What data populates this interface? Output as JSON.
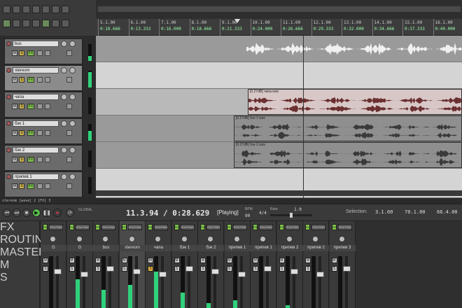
{
  "ruler": {
    "bars": [
      {
        "bar": "5.1.00",
        "time": "0:10.666"
      },
      {
        "bar": "6.1.00",
        "time": "0:13.333"
      },
      {
        "bar": "7.1.00",
        "time": "0:16.000"
      },
      {
        "bar": "8.1.00",
        "time": "0:18.666"
      },
      {
        "bar": "9.1.00",
        "time": "0:21.333"
      },
      {
        "bar": "10.1.00",
        "time": "0:24.000"
      },
      {
        "bar": "11.1.00",
        "time": "0:26.666"
      },
      {
        "bar": "12.1.00",
        "time": "0:29.333"
      },
      {
        "bar": "13.1.00",
        "time": "0:32.000"
      },
      {
        "bar": "14.1.00",
        "time": "0:34.666"
      },
      {
        "bar": "15.1.00",
        "time": "0:37.333"
      },
      {
        "bar": "16.1.00",
        "time": "0:40.000"
      }
    ]
  },
  "tracks": [
    {
      "name": "bus"
    },
    {
      "name": "stereom"
    },
    {
      "name": "чапа"
    },
    {
      "name": "бэк 1"
    },
    {
      "name": "бэк 2"
    },
    {
      "name": "припев 1"
    }
  ],
  "button_labels": {
    "mute": "M",
    "solo": "S",
    "fx": "FX",
    "routing": "ROUTING"
  },
  "items": {
    "chapa": "[0.27dB] чапа.wav",
    "bek1": "[0.27dB] бэк 1.wav",
    "bek2": "[0.27dB] бэк 2.wav"
  },
  "status_text": "stereom [wave] 2 [FX] 3",
  "transport": {
    "time": "11.3.94 / 0:28.629",
    "state": "[Playing]",
    "bpm_label": "BPM",
    "bpm": "90",
    "time_sig": "4/4",
    "rate_label": "Rate:",
    "rate": "1.0",
    "global_label": "GLOBAL",
    "selection_label": "Selection:",
    "sel_start": "3.1.00",
    "sel_end": "70.1.00",
    "sel_len": "66.4.00"
  },
  "mixer": {
    "strips": [
      "MASTER",
      "G",
      "G",
      "bus",
      "stereom",
      "чапа",
      "бэк 1",
      "бэк 2",
      "припев 1",
      "припев 1",
      "припев 2",
      "припев 2",
      "припев 3"
    ],
    "levels": [
      0.62,
      0,
      0.55,
      0.35,
      0.45,
      0.7,
      0.3,
      0.1,
      0.15,
      0,
      0.05,
      0,
      0
    ]
  },
  "colors": {
    "accent_green": "#2fd17b",
    "fx_green": "#7ec24a",
    "solo_yellow": "#e6b33a",
    "record_red": "#e33355",
    "waveform": "#555555",
    "red_item": "#c06060"
  }
}
